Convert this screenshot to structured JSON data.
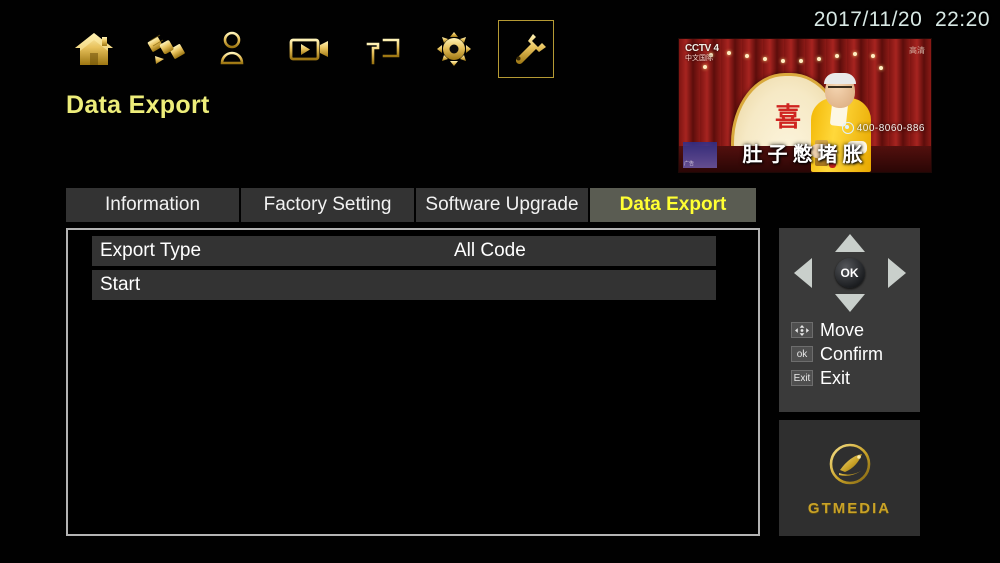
{
  "clock": "2017/11/20  22:20",
  "page_title": "Data Export",
  "topnav": [
    {
      "name": "home-icon",
      "label": "Home",
      "selected": false
    },
    {
      "name": "satellite-icon",
      "label": "Installation",
      "selected": false
    },
    {
      "name": "channel-list-icon",
      "label": "Channel",
      "selected": false
    },
    {
      "name": "video-camera-icon",
      "label": "Multimedia",
      "selected": false
    },
    {
      "name": "media-monitor-icon",
      "label": "Media Player",
      "selected": false
    },
    {
      "name": "gear-icon",
      "label": "Settings",
      "selected": false
    },
    {
      "name": "wrench-icon",
      "label": "Tools",
      "selected": true
    }
  ],
  "tabs": [
    {
      "label": "Information",
      "active": false
    },
    {
      "label": "Factory Setting",
      "active": false
    },
    {
      "label": "Software Upgrade",
      "active": false
    },
    {
      "label": "Data Export",
      "active": true
    }
  ],
  "list": {
    "rows": [
      {
        "label": "Export Type",
        "value": "All Code"
      },
      {
        "label": "Start",
        "value": ""
      }
    ]
  },
  "help": {
    "ok_label": "OK",
    "legend": [
      {
        "key": "move-keycap",
        "key_label": "",
        "text": "Move"
      },
      {
        "key": "ok-keycap",
        "key_label": "ok",
        "text": "Confirm"
      },
      {
        "key": "exit-keycap",
        "key_label": "Exit",
        "text": "Exit"
      }
    ]
  },
  "brand": {
    "logo_icon": "satellite-dish-logo-icon",
    "name": "GTMEDIA"
  },
  "preview": {
    "channel_logo_line1": "CCTV 4",
    "channel_logo_line2": "中文国际",
    "hd_mark": "高清",
    "subtitle": "肚子憋堵胀",
    "phone": "400-8060-886",
    "fan_mark": "喜",
    "corner_watermark": "广告"
  },
  "colors": {
    "gold": "#e5c158",
    "accent_yellow": "#ffff33",
    "title_yellow": "#eded7a",
    "row_bg": "#333333",
    "panel_border": "#b3b3b3",
    "help_bg": "#3a3a3a",
    "brand_gold": "#c9a227",
    "clock_text": "#d7e8e4"
  }
}
